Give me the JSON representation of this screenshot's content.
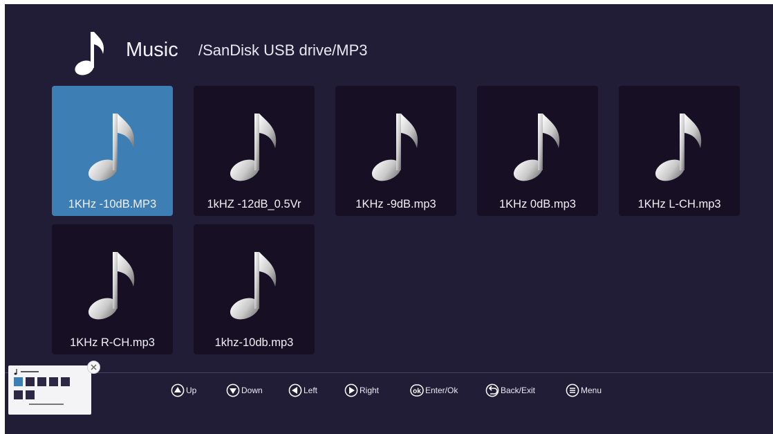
{
  "header": {
    "icon": "music-note-icon",
    "title": "Music",
    "path": "/SanDisk USB drive/MP3"
  },
  "files": [
    {
      "name": "1KHz -10dB.MP3",
      "selected": true
    },
    {
      "name": "1kHZ -12dB_0.5Vr",
      "selected": false
    },
    {
      "name": "1KHz -9dB.mp3",
      "selected": false
    },
    {
      "name": "1KHz 0dB.mp3",
      "selected": false
    },
    {
      "name": "1KHz L-CH.mp3",
      "selected": false
    },
    {
      "name": "1KHz R-CH.mp3",
      "selected": false
    },
    {
      "name": "1khz-10db.mp3",
      "selected": false
    }
  ],
  "hints": [
    {
      "icon": "up-triangle-icon",
      "label": "Up"
    },
    {
      "icon": "down-triangle-icon",
      "label": "Down"
    },
    {
      "icon": "left-triangle-icon",
      "label": "Left"
    },
    {
      "icon": "right-triangle-icon",
      "label": "Right"
    },
    {
      "icon": "ok-icon",
      "icon_text": "ok",
      "label": "Enter/Ok"
    },
    {
      "icon": "back-icon",
      "label": "Back/Exit"
    },
    {
      "icon": "menu-icon",
      "label": "Menu"
    }
  ],
  "preview": {
    "icon": "mini-preview-thumbnail",
    "close_icon": "close-icon"
  },
  "colors": {
    "background": "#211d37",
    "tile": "#170f24",
    "selected_tile": "#3d7fb4",
    "text": "#f0f0f5"
  }
}
